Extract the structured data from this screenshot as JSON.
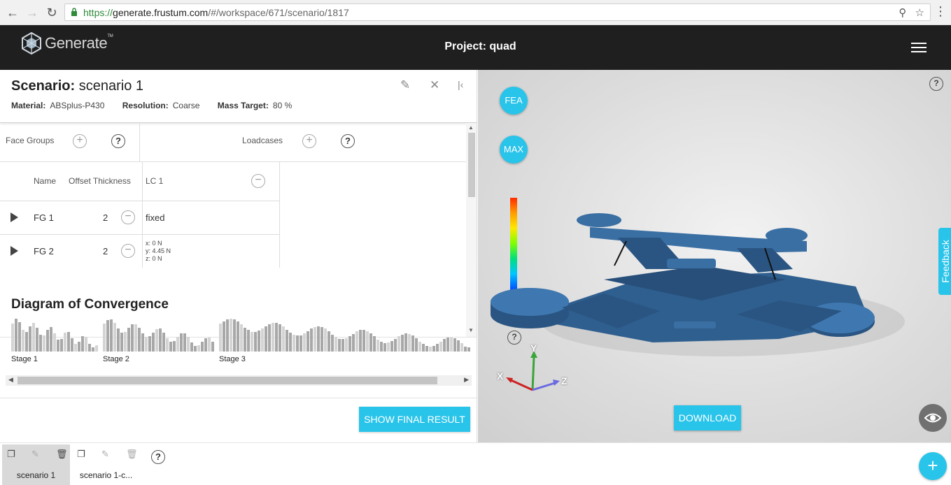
{
  "browser": {
    "url_scheme": "https://",
    "url_host": "generate.frustum.com",
    "url_path": "/#/workspace/671/scenario/1817"
  },
  "header": {
    "logo_text": "Generate",
    "logo_tm": "TM",
    "project_title": "Project: quad"
  },
  "scenario": {
    "title_label": "Scenario:",
    "title_value": "scenario 1",
    "material_label": "Material:",
    "material_value": "ABSplus-P430",
    "resolution_label": "Resolution:",
    "resolution_value": "Coarse",
    "mass_label": "Mass Target:",
    "mass_value": "80 %"
  },
  "face_groups": {
    "header": "Face Groups",
    "loadcases_header": "Loadcases",
    "col_name": "Name",
    "col_offset": "Offset Thickness",
    "col_lc": "LC 1",
    "rows": [
      {
        "name": "FG 1",
        "offset": "2",
        "load": "fixed"
      },
      {
        "name": "FG 2",
        "offset": "2",
        "load_x": "x: 0 N",
        "load_y": "y: 4.45 N",
        "load_z": "z: 0 N"
      }
    ]
  },
  "convergence": {
    "title": "Diagram of Convergence",
    "stages": [
      "Stage 1",
      "Stage 2",
      "Stage 3"
    ]
  },
  "buttons": {
    "show_final": "SHOW FINAL RESULT",
    "fea": "FEA",
    "max": "MAX",
    "download": "DOWNLOAD",
    "feedback": "Feedback",
    "add": "+"
  },
  "axes": {
    "x": "X",
    "y": "Y",
    "z": "Z"
  },
  "tabs": [
    {
      "label": "scenario 1",
      "active": true
    },
    {
      "label": "scenario 1-c...",
      "active": false
    }
  ],
  "colors": {
    "accent": "#29c4ea",
    "header": "#1f1f1f",
    "model": "#2f5f8f"
  }
}
